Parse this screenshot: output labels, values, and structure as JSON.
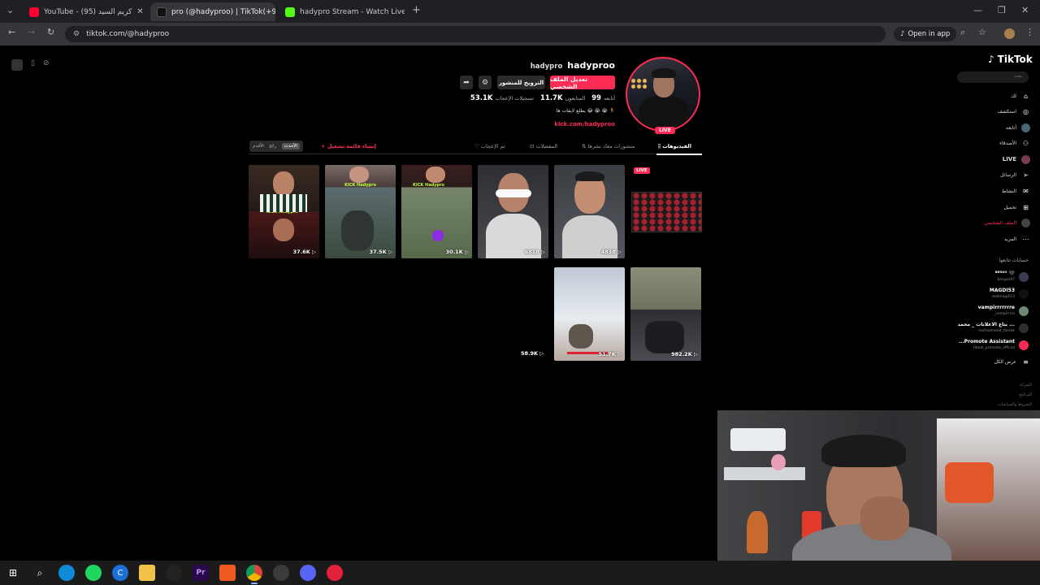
{
  "browser": {
    "tabs": [
      {
        "title": "YouTube - كريم السيد (95)"
      },
      {
        "title": "pro (@hadyproo) | TikTok(+99)"
      },
      {
        "title": "hadypro Stream - Watch Live"
      }
    ],
    "new_tab": "+",
    "url": "tiktok.com/@hadyproo",
    "open_in_app": "Open in app"
  },
  "profile": {
    "username": "hadyproo",
    "nickname": "hadypro",
    "live_badge": "LIVE",
    "edit_button": "تعديل الملف الشخصي",
    "promote_button": "الترويج للمنشور",
    "stats": [
      {
        "value": "99",
        "label": "أتابعه"
      },
      {
        "value": "11.7K",
        "label": "المتابعون"
      },
      {
        "value": "53.1K",
        "label": "تسجيلات الإعجاب"
      }
    ],
    "bio": "يطلع لايفات ها 😂 😭 😭 🏃",
    "link": "kick.com/hadyproo"
  },
  "tabs": [
    {
      "label": "الفيديوهات"
    },
    {
      "label": "منشورات معاد نشرها"
    },
    {
      "label": "المفضلات"
    },
    {
      "label": "تم الإعجاب"
    }
  ],
  "new_list": "+ إنشاء قائمة تشغيل",
  "sort": [
    "الأحدث",
    "رائج",
    "الأقدم"
  ],
  "videos": [
    {
      "views": "37.6K ▷",
      "tag": "KICK Hadypro"
    },
    {
      "views": "37.5K ▷",
      "tag": "KICK Hadypro"
    },
    {
      "views": "30.1K ▷",
      "tag": "KICK Hadypro"
    },
    {
      "views": "6818 ▷",
      "tag": ""
    },
    {
      "views": "4838 ▷",
      "tag": ""
    },
    {
      "views": "51.7K ▷",
      "tag": ""
    },
    {
      "views": "982.2K ▷",
      "tag": ""
    }
  ],
  "orphan_views": "58.9K ▷",
  "live_tile_badge": "LIVE",
  "sidebar": {
    "logo": "TikTok",
    "search_placeholder": "بحث",
    "nav": [
      {
        "label": "لك",
        "icon": "home-icon"
      },
      {
        "label": "استكشف",
        "icon": "compass-icon"
      },
      {
        "label": "أتابعه",
        "icon": "following-icon"
      },
      {
        "label": "الأصدقاء",
        "icon": "friends-icon"
      },
      {
        "label": "LIVE",
        "icon": "live-icon"
      },
      {
        "label": "الرسائل",
        "icon": "messages-icon"
      },
      {
        "label": "النشاط",
        "icon": "activity-icon"
      },
      {
        "label": "تحميل",
        "icon": "upload-icon"
      },
      {
        "label": "الملف الشخصي",
        "icon": "profile-icon"
      },
      {
        "label": "المزيد",
        "icon": "more-icon"
      }
    ],
    "following_header": "حسابات تتابعها",
    "following": [
      {
        "name": "ᴮᴱᴿᴳᴼ 🖤",
        "handle": "bergoo97"
      },
      {
        "name": "MAGDI53",
        "handle": "realmagdi53"
      },
      {
        "name": "vampirrrrrrre",
        "handle": "_vampirrrre"
      },
      {
        "name": "بتاع الاعلانات _ محمد ...",
        "handle": "mohaameed_fareek"
      },
      {
        "name": "...Promote Assistant",
        "handle": "tiktok_promote_official"
      }
    ],
    "see_all": "عرض الكل",
    "footer": [
      "الشركة",
      "البرنامج",
      "الشروط والسياسات"
    ]
  }
}
